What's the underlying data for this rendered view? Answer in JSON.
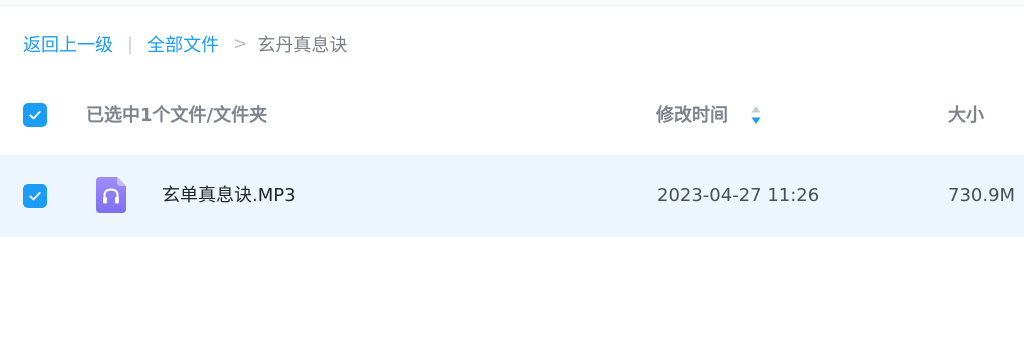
{
  "breadcrumb": {
    "back_label": "返回上一级",
    "divider": "|",
    "all_files_label": "全部文件",
    "separator": ">",
    "current_folder": "玄丹真息诀"
  },
  "header": {
    "select_all_checked": true,
    "selected_summary": "已选中1个文件/文件夹",
    "modified_label": "修改时间",
    "size_label": "大小",
    "sort_icon": "sort-icon"
  },
  "files": [
    {
      "checked": true,
      "icon": "audio-file-icon",
      "name": "玄单真息诀.MP3",
      "modified": "2023-04-27 11:26",
      "size": "730.9M"
    }
  ],
  "colors": {
    "accent": "#1b9cf5",
    "row_selected_bg": "#eef6fd",
    "audio_icon": "#8b7cf6"
  }
}
